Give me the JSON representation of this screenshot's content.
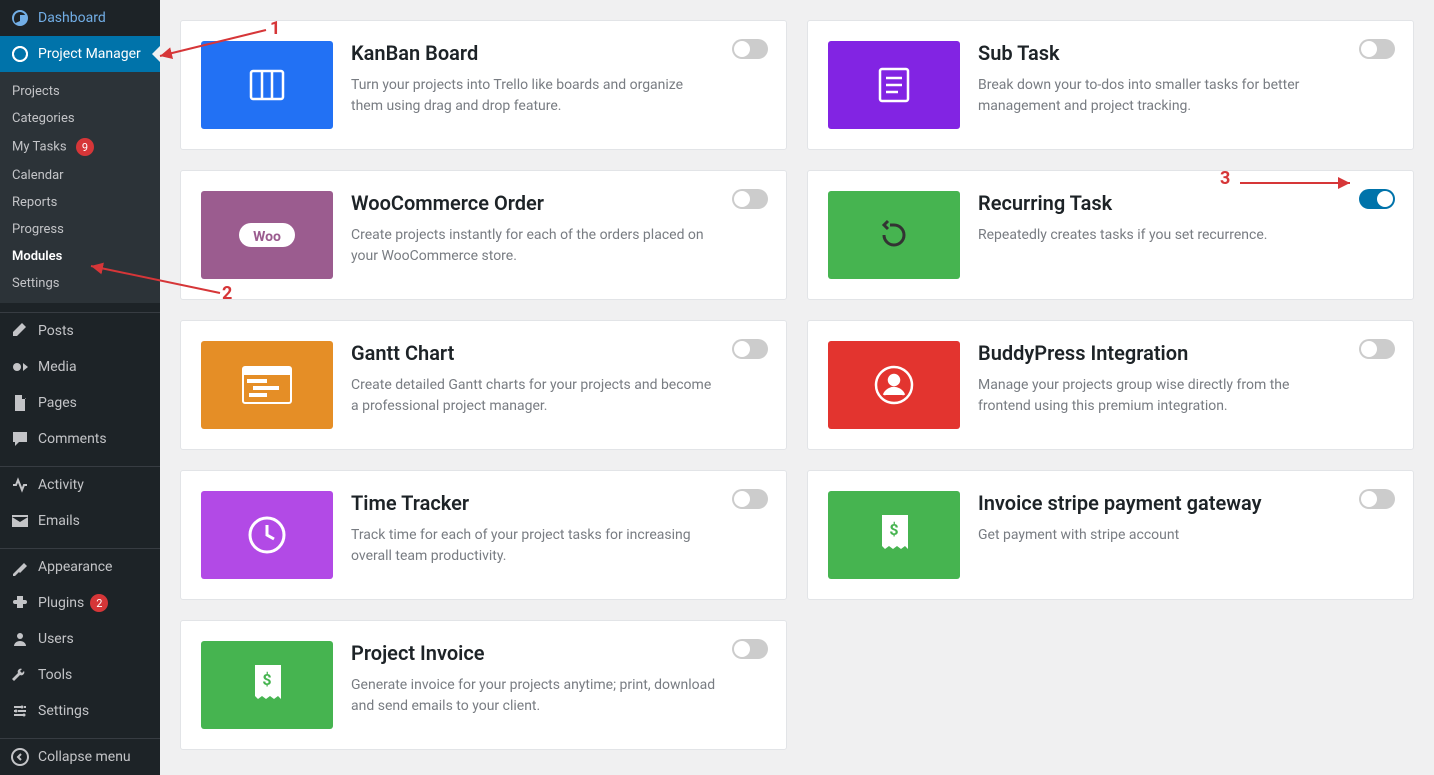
{
  "sidebar": {
    "dashboard": "Dashboard",
    "project_manager": "Project Manager",
    "submenu": {
      "projects": "Projects",
      "categories": "Categories",
      "my_tasks": "My Tasks",
      "my_tasks_badge": "9",
      "calendar": "Calendar",
      "reports": "Reports",
      "progress": "Progress",
      "modules": "Modules",
      "settings": "Settings"
    },
    "posts": "Posts",
    "media": "Media",
    "pages": "Pages",
    "comments": "Comments",
    "activity": "Activity",
    "emails": "Emails",
    "appearance": "Appearance",
    "plugins": "Plugins",
    "plugins_badge": "2",
    "users": "Users",
    "tools": "Tools",
    "settings": "Settings",
    "collapse": "Collapse menu"
  },
  "modules": {
    "left": [
      {
        "title": "KanBan Board",
        "desc": "Turn your projects into Trello like boards and organize them using drag and drop feature.",
        "color": "#2271f4",
        "icon": "kanban",
        "enabled": false
      },
      {
        "title": "WooCommerce Order",
        "desc": "Create projects instantly for each of the orders placed on your WooCommerce store.",
        "color": "#9b5c8f",
        "icon": "woo",
        "enabled": false
      },
      {
        "title": "Gantt Chart",
        "desc": "Create detailed Gantt charts for your projects and become a professional project manager.",
        "color": "#e58e26",
        "icon": "gantt",
        "enabled": false
      },
      {
        "title": "Time Tracker",
        "desc": "Track time for each of your project tasks for increasing overall team productivity.",
        "color": "#b24ae6",
        "icon": "clock",
        "enabled": false
      },
      {
        "title": "Project Invoice",
        "desc": "Generate invoice for your projects anytime; print, download and send emails to your client.",
        "color": "#46b450",
        "icon": "invoice",
        "enabled": false
      }
    ],
    "right": [
      {
        "title": "Sub Task",
        "desc": "Break down your to-dos into smaller tasks for better management and project tracking.",
        "color": "#8224e3",
        "icon": "subtask",
        "enabled": false
      },
      {
        "title": "Recurring Task",
        "desc": "Repeatedly creates tasks if you set recurrence.",
        "color": "#46b450",
        "icon": "recur",
        "enabled": true
      },
      {
        "title": "BuddyPress Integration",
        "desc": "Manage your projects group wise directly from the frontend using this premium integration.",
        "color": "#e3342f",
        "icon": "buddy",
        "enabled": false
      },
      {
        "title": "Invoice stripe payment gateway",
        "desc": "Get payment with stripe account",
        "color": "#46b450",
        "icon": "invoice",
        "enabled": false
      }
    ]
  },
  "annotations": {
    "a1": "1",
    "a2": "2",
    "a3": "3"
  }
}
